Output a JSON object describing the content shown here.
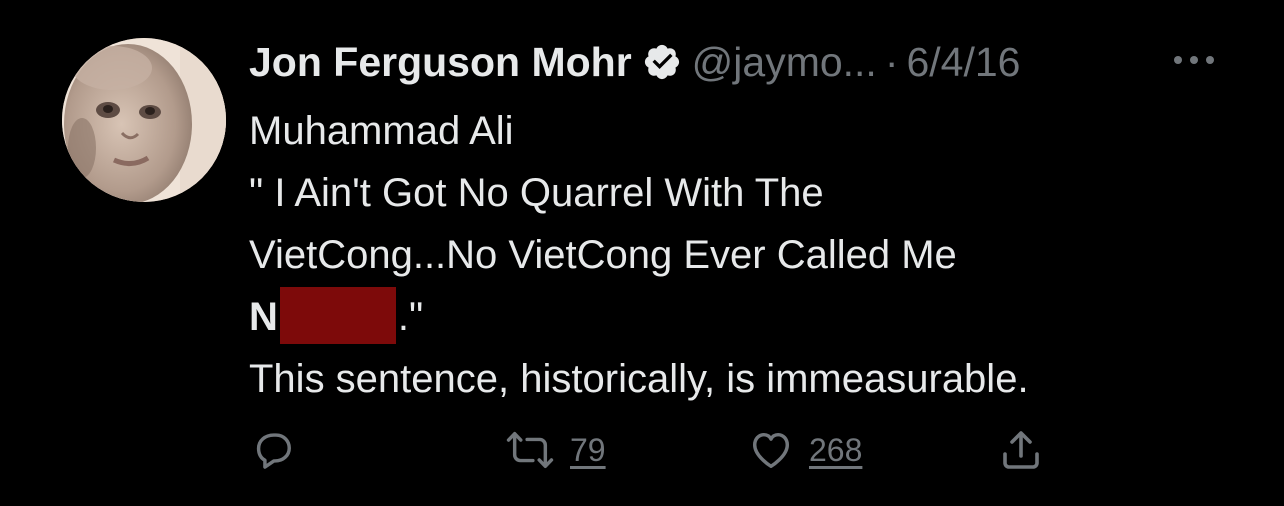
{
  "tweet": {
    "author": {
      "display_name": "Jon Ferguson Mohr",
      "handle": "@jaymo...",
      "verified_icon": "verified-badge-icon",
      "avatar": "baby-photo"
    },
    "separator": "·",
    "date": "6/4/16",
    "more_icon": "more-horizontal-icon",
    "body": {
      "line1": "Muhammad Ali",
      "line2": "\" I Ain't Got No Quarrel With The",
      "line3": "VietCong...No VietCong Ever Called Me",
      "line4_prefix": "N",
      "line4_suffix": ".\"",
      "line5": "This sentence, historically, is immeasurable."
    },
    "actions": {
      "reply_icon": "reply-icon",
      "retweet_icon": "retweet-icon",
      "retweet_count": "79",
      "like_icon": "heart-icon",
      "like_count": "268",
      "share_icon": "share-icon"
    },
    "colors": {
      "background": "#000000",
      "primary_text": "#e7e9ea",
      "secondary_text": "#71767b",
      "redaction": "#7d0a0a"
    }
  }
}
